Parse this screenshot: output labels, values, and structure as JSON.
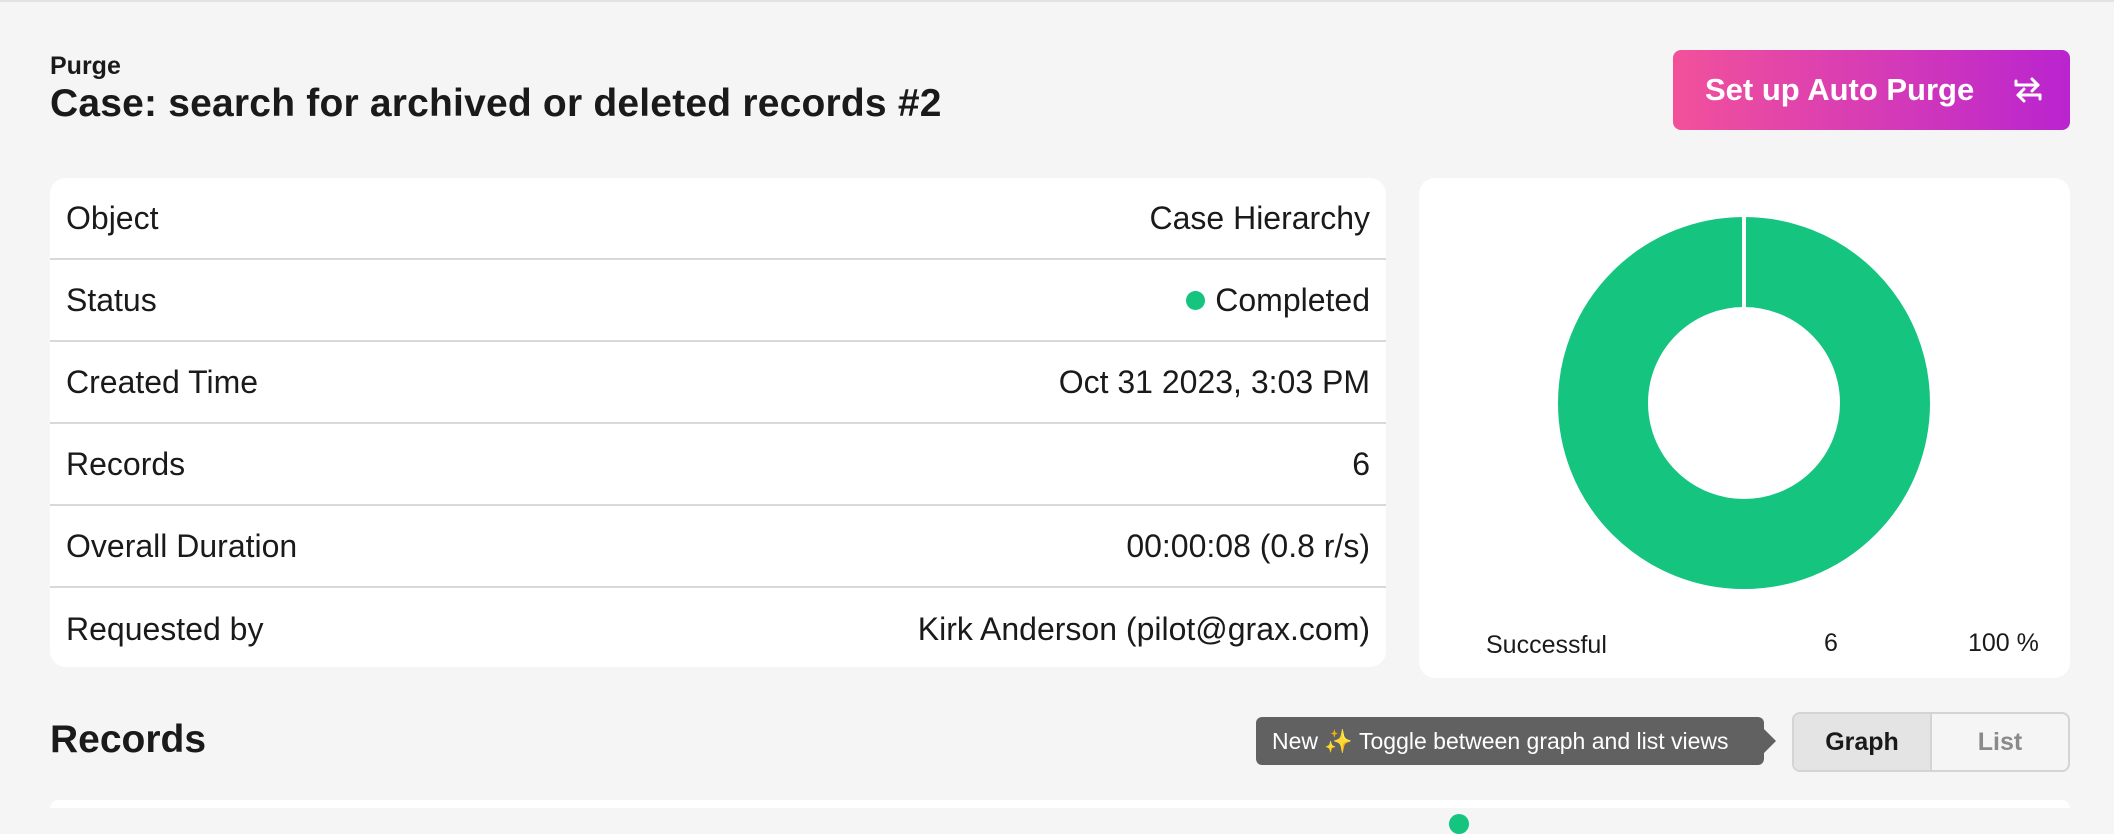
{
  "header": {
    "eyebrow": "Purge",
    "title": "Case: search for archived or deleted records #2",
    "auto_purge_label": "Set up Auto Purge",
    "auto_purge_icon": "repeat-arrows-icon"
  },
  "details": {
    "rows": [
      {
        "label": "Object",
        "value": "Case Hierarchy"
      },
      {
        "label": "Status",
        "value": "Completed",
        "status_color": "#14c47f"
      },
      {
        "label": "Created Time",
        "value": "Oct 31 2023, 3:03 PM"
      },
      {
        "label": "Records",
        "value": "6"
      },
      {
        "label": "Overall Duration",
        "value": "00:00:08 (0.8 r/s)"
      },
      {
        "label": "Requested by",
        "value": "Kirk Anderson (pilot@grax.com)"
      }
    ]
  },
  "chart_data": {
    "type": "pie",
    "series": [
      {
        "name": "Successful",
        "value": 6,
        "percent": "100 %",
        "color": "#14c47f"
      }
    ]
  },
  "records": {
    "title": "Records",
    "tooltip": "New ✨ Toggle between graph and list views",
    "toggle_graph": "Graph",
    "toggle_list": "List",
    "active_view": "Graph"
  },
  "colors": {
    "accent_gradient_start": "#f2519a",
    "accent_gradient_end": "#b924cf",
    "success": "#14c47f",
    "background": "#f5f5f5"
  }
}
